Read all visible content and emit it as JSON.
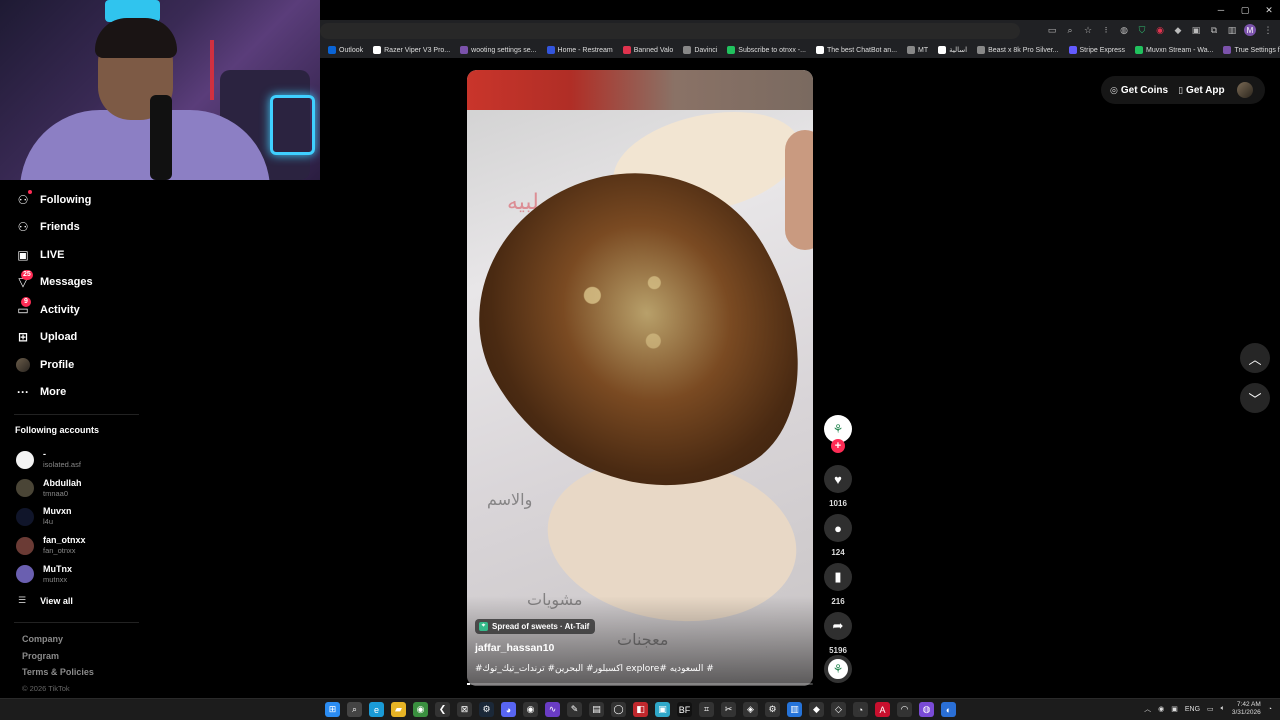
{
  "window": {
    "controls": {
      "minimize": "─",
      "restore": "▢",
      "close": "✕"
    }
  },
  "bookmarks": [
    {
      "label": "Outlook",
      "color": "#0a64d6"
    },
    {
      "label": "Razer Viper V3 Pro...",
      "color": "#ffffff"
    },
    {
      "label": "wooting settings se...",
      "color": "#7b52ab"
    },
    {
      "label": "Home - Restream",
      "color": "#3355dd"
    },
    {
      "label": "Banned Valo",
      "color": "#e0334e"
    },
    {
      "label": "Davinci",
      "color": "#888888"
    },
    {
      "label": "Subscribe to otnxx -...",
      "color": "#21c25e"
    },
    {
      "label": "The best ChatBot an...",
      "color": "#ffffff"
    },
    {
      "label": "MT",
      "color": "#888888"
    },
    {
      "label": "اسالية",
      "color": "#ffffff"
    },
    {
      "label": "Beast x 8k Pro Silver...",
      "color": "#888888"
    },
    {
      "label": "Stripe Express",
      "color": "#635bff"
    },
    {
      "label": "Muvxn Stream - Wa...",
      "color": "#21c25e"
    },
    {
      "label": "True Settings for NV...",
      "color": "#7b52ab"
    }
  ],
  "nav": {
    "items": [
      {
        "label": "Following",
        "icon": "following-icon",
        "glyph": "⚇"
      },
      {
        "label": "Friends",
        "icon": "friends-icon",
        "glyph": "⚇"
      },
      {
        "label": "LIVE",
        "icon": "live-icon",
        "glyph": "▣"
      },
      {
        "label": "Messages",
        "icon": "messages-icon",
        "glyph": "▽",
        "badge": "25"
      },
      {
        "label": "Activity",
        "icon": "activity-icon",
        "glyph": "▭",
        "badge": "9"
      },
      {
        "label": "Upload",
        "icon": "upload-icon",
        "glyph": "⊞"
      },
      {
        "label": "Profile",
        "icon": "profile-avatar",
        "glyph": ""
      },
      {
        "label": "More",
        "icon": "more-icon",
        "glyph": "···"
      }
    ]
  },
  "following_accounts": {
    "title": "Following accounts",
    "accounts": [
      {
        "name": "-",
        "username": "isolated.asf",
        "color": "#f2f2f2"
      },
      {
        "name": "Abdullah",
        "username": "tmnaa0",
        "color": "#4a4536"
      },
      {
        "name": "Muvxn",
        "username": "l4u",
        "color": "#10152a"
      },
      {
        "name": "fan_otnxx",
        "username": "fan_otnxx",
        "color": "#6b3b35"
      },
      {
        "name": "MuTnx",
        "username": "mutnxx",
        "color": "#6a5fb0"
      }
    ],
    "view_all": "View all"
  },
  "footer": {
    "links": [
      "Company",
      "Program",
      "Terms & Policies"
    ],
    "copyright": "© 2026 TikTok"
  },
  "header": {
    "get_coins": "Get Coins",
    "get_app": "Get App"
  },
  "video": {
    "location_chip": "Spread of sweets · At-Taif",
    "username": "jaffar_hassan10",
    "caption": "# السعوديه #explore اكسبلور# البحرين# ترندات_تيك_توك#",
    "progress": 0.01
  },
  "actions": {
    "likes": "1016",
    "comments": "124",
    "saves": "216",
    "shares": "5196"
  },
  "taskbar": {
    "apps": [
      {
        "name": "windows-start-icon",
        "glyph": "⊞",
        "color": "#2b8cf2"
      },
      {
        "name": "search-icon",
        "glyph": "⌕",
        "color": "#444"
      },
      {
        "name": "edge-icon",
        "glyph": "e",
        "color": "#1a9bd7"
      },
      {
        "name": "file-explorer-icon",
        "glyph": "▰",
        "color": "#e6b325"
      },
      {
        "name": "chrome-icon",
        "glyph": "◉",
        "color": "#3a8f3f"
      },
      {
        "name": "app-icon-6",
        "glyph": "❮",
        "color": "#333"
      },
      {
        "name": "app-icon-7",
        "glyph": "⊠",
        "color": "#333"
      },
      {
        "name": "steam-icon",
        "glyph": "⚙",
        "color": "#1b2838"
      },
      {
        "name": "discord-icon",
        "glyph": "◕",
        "color": "#5865f2"
      },
      {
        "name": "app-icon-10",
        "glyph": "◉",
        "color": "#333"
      },
      {
        "name": "app-icon-11",
        "glyph": "∿",
        "color": "#6a3cc4"
      },
      {
        "name": "app-icon-12",
        "glyph": "✎",
        "color": "#333"
      },
      {
        "name": "app-icon-13",
        "glyph": "▤",
        "color": "#333"
      },
      {
        "name": "obs-icon",
        "glyph": "◯",
        "color": "#333"
      },
      {
        "name": "app-icon-15",
        "glyph": "◧",
        "color": "#c0282d"
      },
      {
        "name": "app-icon-16",
        "glyph": "▣",
        "color": "#2fa8c9"
      },
      {
        "name": "app-icon-17",
        "glyph": "BF",
        "color": "#111"
      },
      {
        "name": "app-icon-18",
        "glyph": "⌗",
        "color": "#333"
      },
      {
        "name": "app-icon-19",
        "glyph": "✂",
        "color": "#333"
      },
      {
        "name": "app-icon-20",
        "glyph": "◈",
        "color": "#333"
      },
      {
        "name": "settings-icon",
        "glyph": "⚙",
        "color": "#333"
      },
      {
        "name": "app-icon-22",
        "glyph": "▥",
        "color": "#2573d9"
      },
      {
        "name": "app-icon-23",
        "glyph": "◆",
        "color": "#333"
      },
      {
        "name": "app-icon-24",
        "glyph": "◇",
        "color": "#333"
      },
      {
        "name": "app-icon-25",
        "glyph": "◔",
        "color": "#333"
      },
      {
        "name": "app-icon-26",
        "glyph": "A",
        "color": "#c8102e"
      },
      {
        "name": "app-icon-27",
        "glyph": "◠",
        "color": "#333"
      },
      {
        "name": "app-icon-28",
        "glyph": "◍",
        "color": "#7a4bd6"
      },
      {
        "name": "app-icon-29",
        "glyph": "◐",
        "color": "#2a6fd6"
      }
    ],
    "tray": {
      "language": "ENG",
      "time": "7:42 AM",
      "date": "3/31/2026"
    }
  }
}
